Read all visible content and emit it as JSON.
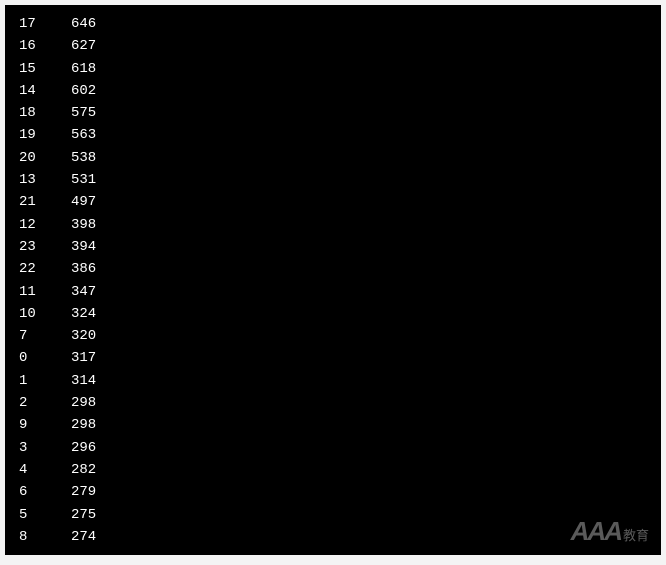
{
  "terminal": {
    "rows": [
      {
        "left": "17",
        "right": "646"
      },
      {
        "left": "16",
        "right": "627"
      },
      {
        "left": "15",
        "right": "618"
      },
      {
        "left": "14",
        "right": "602"
      },
      {
        "left": "18",
        "right": "575"
      },
      {
        "left": "19",
        "right": "563"
      },
      {
        "left": "20",
        "right": "538"
      },
      {
        "left": "13",
        "right": "531"
      },
      {
        "left": "21",
        "right": "497"
      },
      {
        "left": "12",
        "right": "398"
      },
      {
        "left": "23",
        "right": "394"
      },
      {
        "left": "22",
        "right": "386"
      },
      {
        "left": "11",
        "right": "347"
      },
      {
        "left": "10",
        "right": "324"
      },
      {
        "left": "7",
        "right": "320"
      },
      {
        "left": "0",
        "right": "317"
      },
      {
        "left": "1",
        "right": "314"
      },
      {
        "left": "2",
        "right": "298"
      },
      {
        "left": "9",
        "right": "298"
      },
      {
        "left": "3",
        "right": "296"
      },
      {
        "left": "4",
        "right": "282"
      },
      {
        "left": "6",
        "right": "279"
      },
      {
        "left": "5",
        "right": "275"
      },
      {
        "left": "8",
        "right": "274"
      }
    ]
  },
  "watermark": {
    "big": "AAA",
    "small": "教育"
  }
}
